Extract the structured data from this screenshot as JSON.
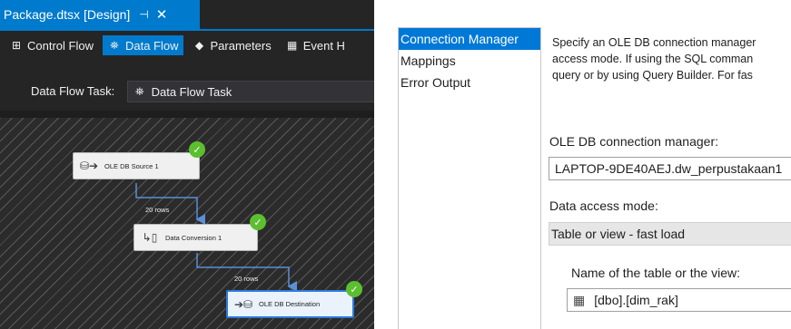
{
  "document_tab": {
    "title": "Package.dtsx [Design]",
    "pin_icon": "⊣",
    "close_icon": "✕"
  },
  "designer_tabs": [
    {
      "label": "Control Flow",
      "icon": "⊞",
      "active": false
    },
    {
      "label": "Data Flow",
      "icon": "⛯",
      "active": true
    },
    {
      "label": "Parameters",
      "icon": "◆",
      "active": false
    },
    {
      "label": "Event H",
      "icon": "▦",
      "active": false
    }
  ],
  "task_bar": {
    "label": "Data Flow Task:",
    "value": "Data Flow Task",
    "icon": "⛯"
  },
  "nodes": {
    "source": {
      "label": "OLE DB Source 1",
      "icon": "⛁➔"
    },
    "conversion": {
      "label": "Data Conversion 1",
      "icon": "↳▯"
    },
    "destination": {
      "label": "OLE DB Destination",
      "icon": "➔⛁"
    }
  },
  "path_labels": {
    "path1": "20 rows",
    "path2": "20 rows"
  },
  "check_glyph": "✓",
  "editor": {
    "nav": [
      "Connection Manager",
      "Mappings",
      "Error Output"
    ],
    "description": [
      "Specify an OLE DB connection manager",
      "access mode. If using the SQL comman",
      "query or by using Query Builder. For fas"
    ],
    "connection_label": "OLE DB connection manager:",
    "connection_value": "LAPTOP-9DE40AEJ.dw_perpustakaan1",
    "mode_label": "Data access mode:",
    "mode_value": "Table or view - fast load",
    "table_label": "Name of the table or the view:",
    "table_value": "[dbo].[dim_rak]",
    "table_icon": "▦"
  },
  "colors": {
    "accent": "#007acc",
    "canvas": "#2b2b2b",
    "success": "#5bbf2f",
    "selection": "#0078d7"
  }
}
